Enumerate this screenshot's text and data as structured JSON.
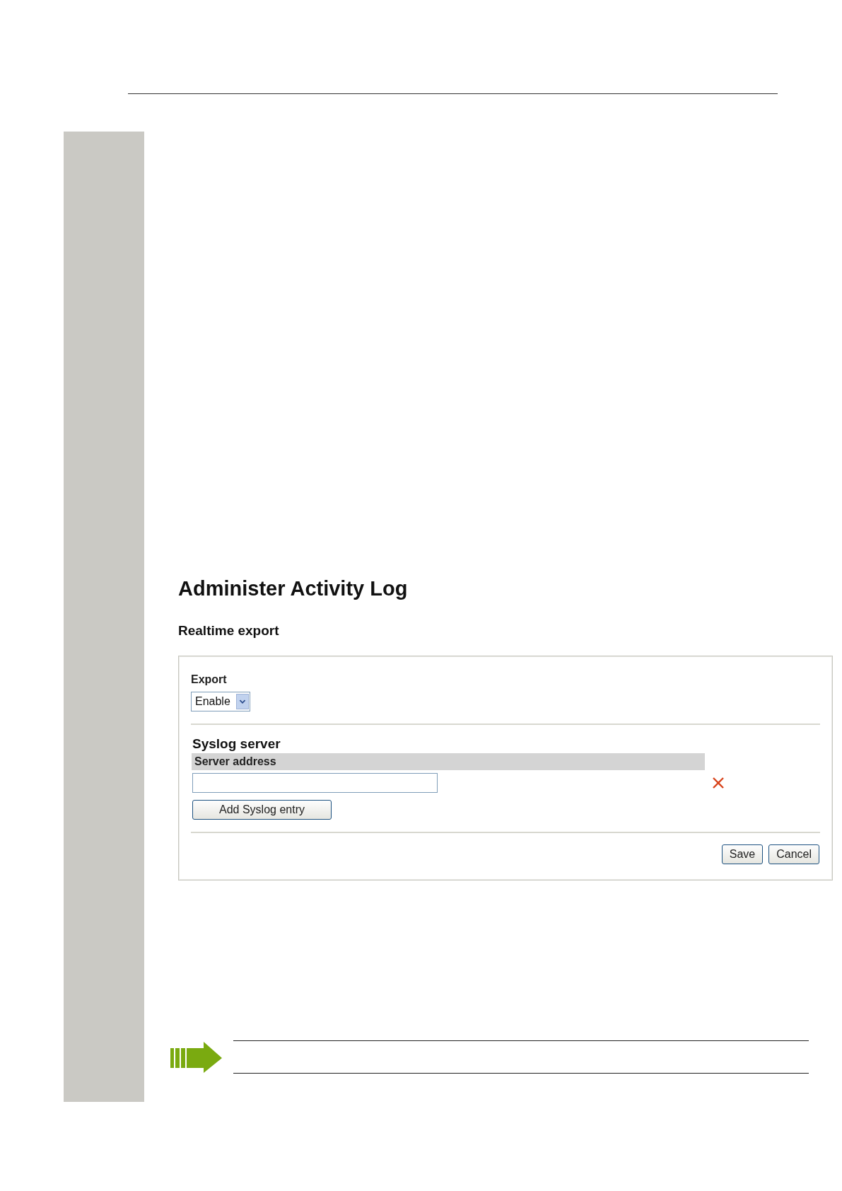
{
  "title": "Administer Activity Log",
  "section": "Realtime export",
  "export": {
    "label": "Export",
    "value": "Enable"
  },
  "syslog": {
    "heading": "Syslog server",
    "column": "Server address",
    "add_button": "Add Syslog entry"
  },
  "buttons": [
    "Save",
    "Cancel"
  ]
}
